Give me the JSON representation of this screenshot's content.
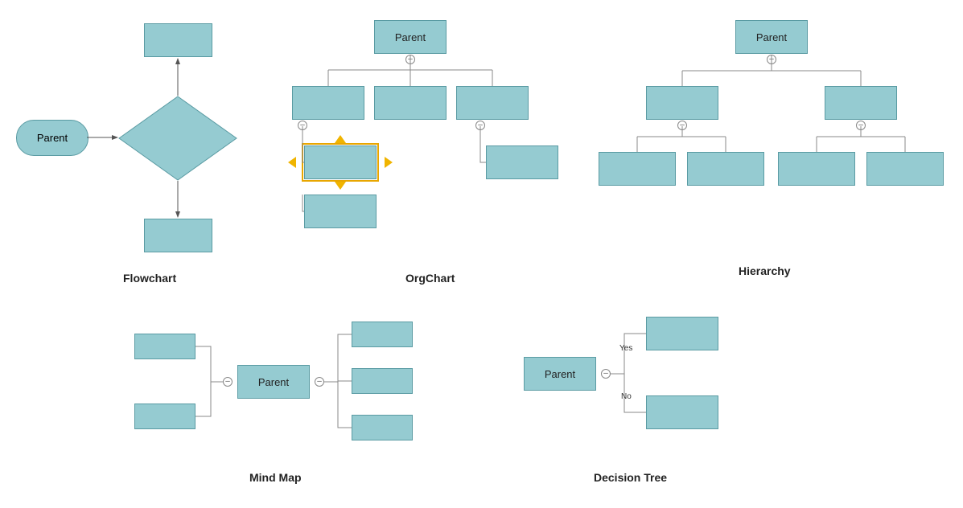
{
  "diagrams": {
    "flowchart": {
      "title": "Flowchart",
      "nodes": {
        "parent": {
          "label": "Parent"
        }
      }
    },
    "orgchart": {
      "title": "OrgChart",
      "nodes": {
        "parent": {
          "label": "Parent"
        }
      }
    },
    "hierarchy": {
      "title": "Hierarchy",
      "nodes": {
        "parent": {
          "label": "Parent"
        }
      }
    },
    "mindmap": {
      "title": "Mind Map",
      "nodes": {
        "parent": {
          "label": "Parent"
        }
      }
    },
    "decisiontree": {
      "title": "Decision Tree",
      "nodes": {
        "parent": {
          "label": "Parent"
        }
      },
      "edges": {
        "yes": "Yes",
        "no": "No"
      }
    }
  },
  "colors": {
    "nodeFill": "#95cbd1",
    "nodeStroke": "#5a9ba3",
    "selection": "#e8a600"
  },
  "chart_data": [
    {
      "type": "diagram",
      "subtype": "flowchart",
      "title": "Flowchart",
      "nodes": [
        {
          "id": "start",
          "label": "Parent",
          "shape": "terminator"
        },
        {
          "id": "dec",
          "label": "",
          "shape": "decision"
        },
        {
          "id": "top",
          "label": "",
          "shape": "process"
        },
        {
          "id": "bot",
          "label": "",
          "shape": "process"
        }
      ],
      "edges": [
        {
          "from": "start",
          "to": "dec"
        },
        {
          "from": "dec",
          "to": "top"
        },
        {
          "from": "dec",
          "to": "bot"
        }
      ]
    },
    {
      "type": "diagram",
      "subtype": "orgchart",
      "title": "OrgChart",
      "nodes": [
        {
          "id": "p",
          "label": "Parent"
        },
        {
          "id": "c1",
          "label": ""
        },
        {
          "id": "c2",
          "label": ""
        },
        {
          "id": "c3",
          "label": ""
        },
        {
          "id": "c1a",
          "label": "",
          "selected": true
        },
        {
          "id": "c1b",
          "label": ""
        },
        {
          "id": "c3a",
          "label": ""
        }
      ],
      "edges": [
        {
          "from": "p",
          "to": "c1"
        },
        {
          "from": "p",
          "to": "c2"
        },
        {
          "from": "p",
          "to": "c3"
        },
        {
          "from": "c1",
          "to": "c1a"
        },
        {
          "from": "c1",
          "to": "c1b"
        },
        {
          "from": "c3",
          "to": "c3a"
        }
      ]
    },
    {
      "type": "diagram",
      "subtype": "hierarchy",
      "title": "Hierarchy",
      "nodes": [
        {
          "id": "p",
          "label": "Parent"
        },
        {
          "id": "l",
          "label": ""
        },
        {
          "id": "r",
          "label": ""
        },
        {
          "id": "l1",
          "label": ""
        },
        {
          "id": "l2",
          "label": ""
        },
        {
          "id": "r1",
          "label": ""
        },
        {
          "id": "r2",
          "label": ""
        }
      ],
      "edges": [
        {
          "from": "p",
          "to": "l"
        },
        {
          "from": "p",
          "to": "r"
        },
        {
          "from": "l",
          "to": "l1"
        },
        {
          "from": "l",
          "to": "l2"
        },
        {
          "from": "r",
          "to": "r1"
        },
        {
          "from": "r",
          "to": "r2"
        }
      ]
    },
    {
      "type": "diagram",
      "subtype": "mindmap",
      "title": "Mind Map",
      "nodes": [
        {
          "id": "p",
          "label": "Parent"
        },
        {
          "id": "l1",
          "label": ""
        },
        {
          "id": "l2",
          "label": ""
        },
        {
          "id": "r1",
          "label": ""
        },
        {
          "id": "r2",
          "label": ""
        },
        {
          "id": "r3",
          "label": ""
        }
      ],
      "edges": [
        {
          "from": "p",
          "to": "l1",
          "side": "left"
        },
        {
          "from": "p",
          "to": "l2",
          "side": "left"
        },
        {
          "from": "p",
          "to": "r1",
          "side": "right"
        },
        {
          "from": "p",
          "to": "r2",
          "side": "right"
        },
        {
          "from": "p",
          "to": "r3",
          "side": "right"
        }
      ]
    },
    {
      "type": "diagram",
      "subtype": "decisiontree",
      "title": "Decision Tree",
      "nodes": [
        {
          "id": "p",
          "label": "Parent"
        },
        {
          "id": "y",
          "label": ""
        },
        {
          "id": "n",
          "label": ""
        }
      ],
      "edges": [
        {
          "from": "p",
          "to": "y",
          "label": "Yes"
        },
        {
          "from": "p",
          "to": "n",
          "label": "No"
        }
      ]
    }
  ]
}
